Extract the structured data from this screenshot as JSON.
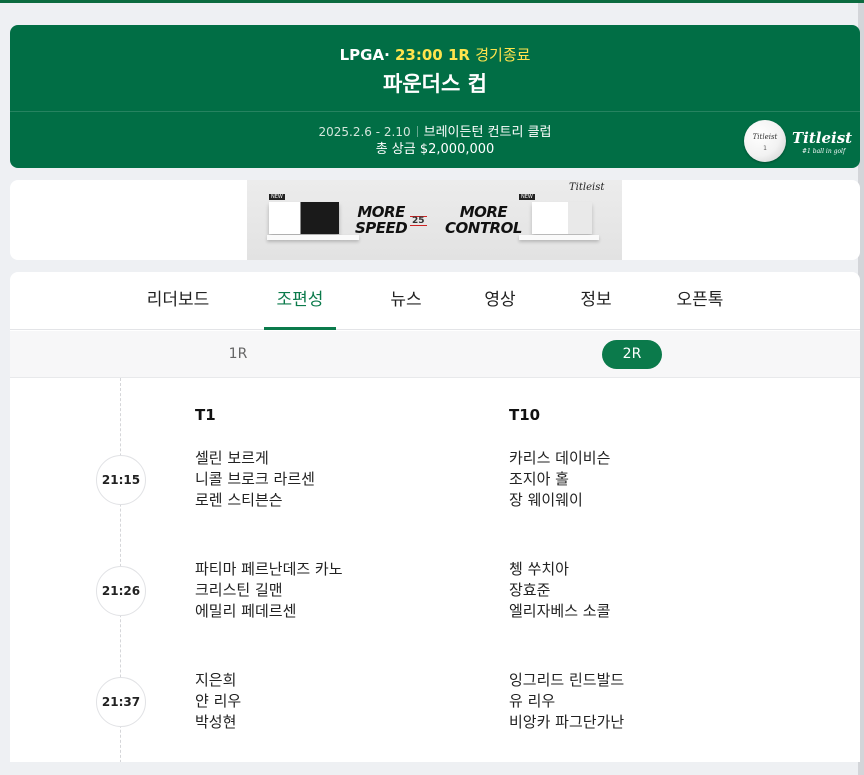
{
  "header": {
    "league": "LPGA",
    "dot": "·",
    "time": "23:00",
    "round": "1R",
    "status": "경기종료",
    "title": "파운더스 컵",
    "dates": "2025.2.6 - 2.10",
    "venue": "브레이든턴 컨트리 클럽",
    "prize": "총 상금 $2,000,000",
    "sponsor_icon": "titleist-golf-ball-icon",
    "sponsor_logo": "titleist-logo"
  },
  "ad": {
    "text_left": "MORE SPEED",
    "text_left_l1": "MORE",
    "text_left_l2": "SPEED",
    "vs": "25",
    "text_right_l1": "MORE",
    "text_right_l2": "CONTROL",
    "brand": "Titleist"
  },
  "tabs": [
    "리더보드",
    "조편성",
    "뉴스",
    "영상",
    "정보",
    "오픈톡"
  ],
  "active_tab": "조편성",
  "rounds": [
    "1R",
    "2R"
  ],
  "active_round": "2R",
  "columns": [
    "T1",
    "T10"
  ],
  "groups": [
    {
      "time": "21:15",
      "t1": [
        "셀린 보르게",
        "니콜 브로크 라르센",
        "로렌 스티븐슨"
      ],
      "t10": [
        "카리스 데이비슨",
        "조지아 홀",
        "장 웨이웨이"
      ]
    },
    {
      "time": "21:26",
      "t1": [
        "파티마 페르난데즈 카노",
        "크리스틴 길맨",
        "에밀리 페데르센"
      ],
      "t10": [
        "쳉 쑤치아",
        "장효준",
        "엘리자베스 소콜"
      ]
    },
    {
      "time": "21:37",
      "t1": [
        "지은희",
        "얀 리우",
        "박성현"
      ],
      "t10": [
        "잉그리드 린드발드",
        "유 리우",
        "비앙카 파그단가난"
      ]
    }
  ],
  "colors": {
    "brand_green": "#016e45",
    "accent_green": "#0b7a4b",
    "highlight_yellow": "#ffe44d"
  }
}
